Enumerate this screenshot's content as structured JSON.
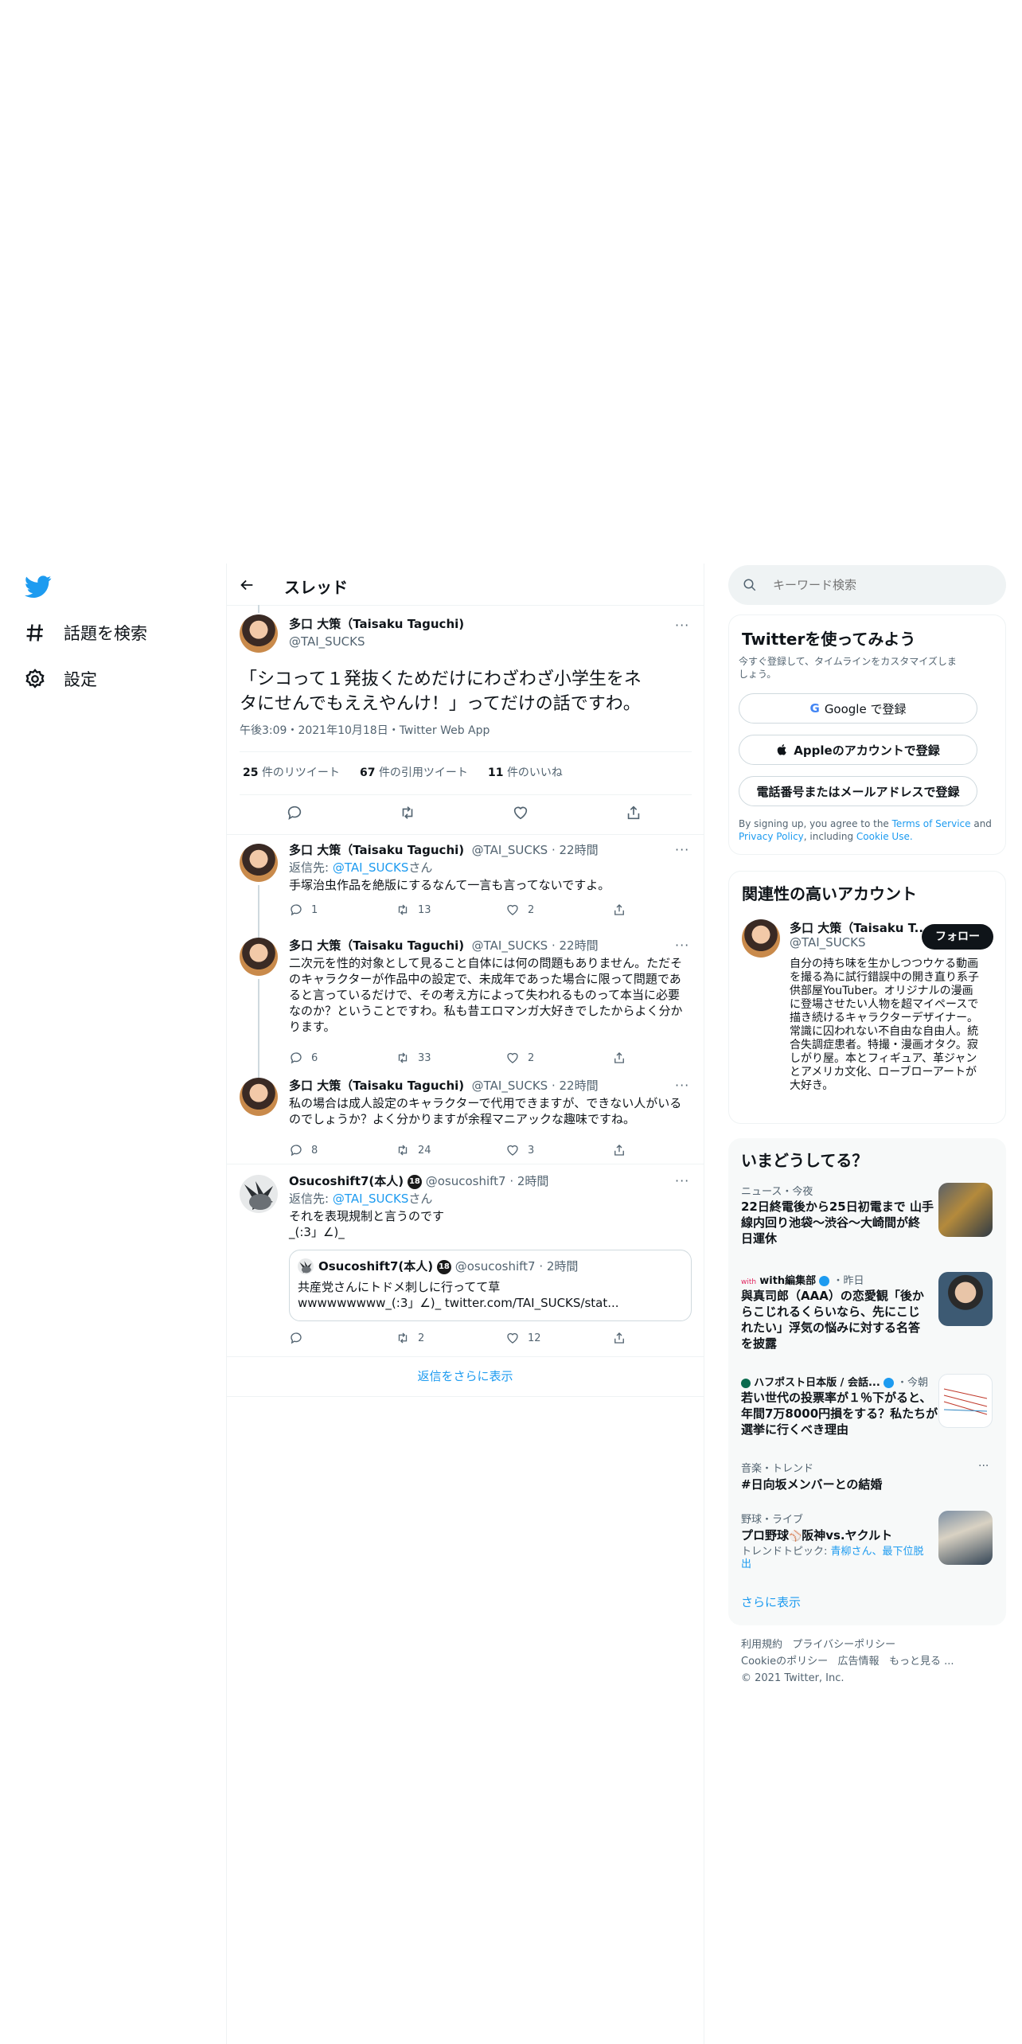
{
  "nav": {
    "explore_label": "話題を検索",
    "settings_label": "設定"
  },
  "header": {
    "title": "スレッド"
  },
  "main_tweet": {
    "name": "多口 大策（Taisaku Taguchi)",
    "handle": "@TAI_SUCKS",
    "text_line1": "「シコって１発抜くためだけにわざわざ小学生をネ",
    "text_line2": "タにせんでもええやんけ！」ってだけの話ですわ。",
    "meta": "午後3:09・2021年10月18日・Twitter Web App",
    "retweets_count": "25",
    "retweets_label": "件のリツイート",
    "quotes_count": "67",
    "quotes_label": "件の引用ツイート",
    "likes_count": "11",
    "likes_label": "件のいいね"
  },
  "replies": [
    {
      "name": "多口 大策（Taisaku Taguchi)",
      "handle_time": "@TAI_SUCKS · 22時間",
      "reply_prefix": "返信先: ",
      "reply_to": "@TAI_SUCKS",
      "reply_suffix": "さん",
      "lines": [
        "手塚治虫作品を絶版にするなんて一言も言ってないですよ。"
      ],
      "reply_count": "1",
      "retweet_count": "13",
      "like_count": "2"
    },
    {
      "name": "多口 大策（Taisaku Taguchi)",
      "handle_time": "@TAI_SUCKS · 22時間",
      "lines": [
        "二次元を性的対象として見ること自体には何の問題もありません。ただそ",
        "のキャラクターが作品中の設定で、未成年であった場合に限って問題であ",
        "ると言っているだけで、その考え方によって失われるものって本当に必要",
        "なのか？ということですわ。私も昔エロマンガ大好きでしたからよく分か",
        "ります。"
      ],
      "reply_count": "6",
      "retweet_count": "33",
      "like_count": "2"
    },
    {
      "name": "多口 大策（Taisaku Taguchi)",
      "handle_time": "@TAI_SUCKS · 22時間",
      "lines": [
        "私の場合は成人設定のキャラクターで代用できますが、できない人がいる",
        "のでしょうか？よく分かりますが余程マニアックな趣味ですね。"
      ],
      "reply_count": "8",
      "retweet_count": "24",
      "like_count": "3"
    },
    {
      "name": "Osucoshift7(本人)",
      "badge": "18",
      "handle_time": "@osucoshift7 · 2時間",
      "reply_prefix": "返信先: ",
      "reply_to": "@TAI_SUCKS",
      "reply_suffix": "さん",
      "lines": [
        "それを表現規制と言うのです",
        "_(:3」∠)_"
      ],
      "quote": {
        "name": "Osucoshift7(本人)",
        "badge": "18",
        "handle_time": "@osucoshift7 · 2時間",
        "line1": "共産党さんにトドメ刺しに行ってて草",
        "line2": "wwwwwwwww_(:3」∠)_ twitter.com/TAI_SUCKS/stat..."
      },
      "reply_count": "",
      "retweet_count": "2",
      "like_count": "12"
    }
  ],
  "show_more_replies": "返信をさらに表示",
  "search": {
    "placeholder": "キーワード検索"
  },
  "signup": {
    "title": "Twitterを使ってみよう",
    "subtitle_line1": "今すぐ登録して、タイムラインをカスタマイズしま",
    "subtitle_line2": "しょう。",
    "google_label": "Google で登録",
    "apple_label": "Appleのアカウントで登録",
    "phone_label": "電話番号またはメールアドレスで登録",
    "terms_prefix": "By signing up, you agree to the ",
    "terms_link": "Terms of Service",
    "terms_and": " and",
    "privacy_link": "Privacy Policy",
    "including": ", including ",
    "cookie_link": "Cookie Use."
  },
  "related": {
    "title": "関連性の高いアカウント",
    "name": "多口 大策（Taisaku T...",
    "handle": "@TAI_SUCKS",
    "follow_label": "フォロー",
    "bio_lines": [
      "自分の持ち味を生かしつつウケる動画",
      "を撮る為に試行錯誤中の開き直り系子",
      "供部屋YouTuber。オリジナルの漫画",
      "に登場させたい人物を超マイペースで",
      "描き続けるキャラクターデザイナー。",
      "常識に囚われない不自由な自由人。統",
      "合失調症患者。特撮・漫画オタク。寂",
      "しがり屋。本とフィギュア、革ジャン",
      "とアメリカ文化、ローブローアートが",
      "大好き。"
    ]
  },
  "trends": {
    "title": "いまどうしてる？",
    "items": [
      {
        "context": "ニュース・今夜",
        "lines": [
          "22日終電後から25日初電まで 山手",
          "線内回り池袋～渋谷～大崎間が終",
          "日運休"
        ]
      },
      {
        "context": "with編集部",
        "context_suffix": "・昨日",
        "lines": [
          "與真司郎（AAA）の恋愛観「後か",
          "らこじれるくらいなら、先にこじ",
          "れたい」浮気の悩みに対する名答",
          "を披露"
        ]
      },
      {
        "context": "ハフポスト日本版 / 会話...",
        "context_suffix": "・今朝",
        "lines": [
          "若い世代の投票率が１％下がると、",
          "年間7万8000円損をする？私たちが",
          "選挙に行くべき理由"
        ]
      },
      {
        "context": "音楽・トレンド",
        "lines": [
          "#日向坂メンバーとの結婚"
        ]
      },
      {
        "context": "野球・ライブ",
        "lines": [
          "プロ野球",
          "阪神vs.ヤクルト"
        ],
        "topic_prefix": "トレンドトピック: ",
        "topic_line1": "青柳さん、最下位脱",
        "topic_line2": "出"
      }
    ],
    "show_more": "さらに表示"
  },
  "footer": {
    "line1a": "利用規約",
    "line1b": "プライバシーポリシー",
    "line2a": "Cookieのポリシー",
    "line2b": "広告情報",
    "line2c": "もっと見る ...",
    "copyright": "© 2021 Twitter, Inc."
  },
  "colors": {
    "accent": "#1d9bf0",
    "text": "#0f1419",
    "muted": "#536471",
    "border": "#eff3f4",
    "trends_bg": "#f7f9f9"
  }
}
